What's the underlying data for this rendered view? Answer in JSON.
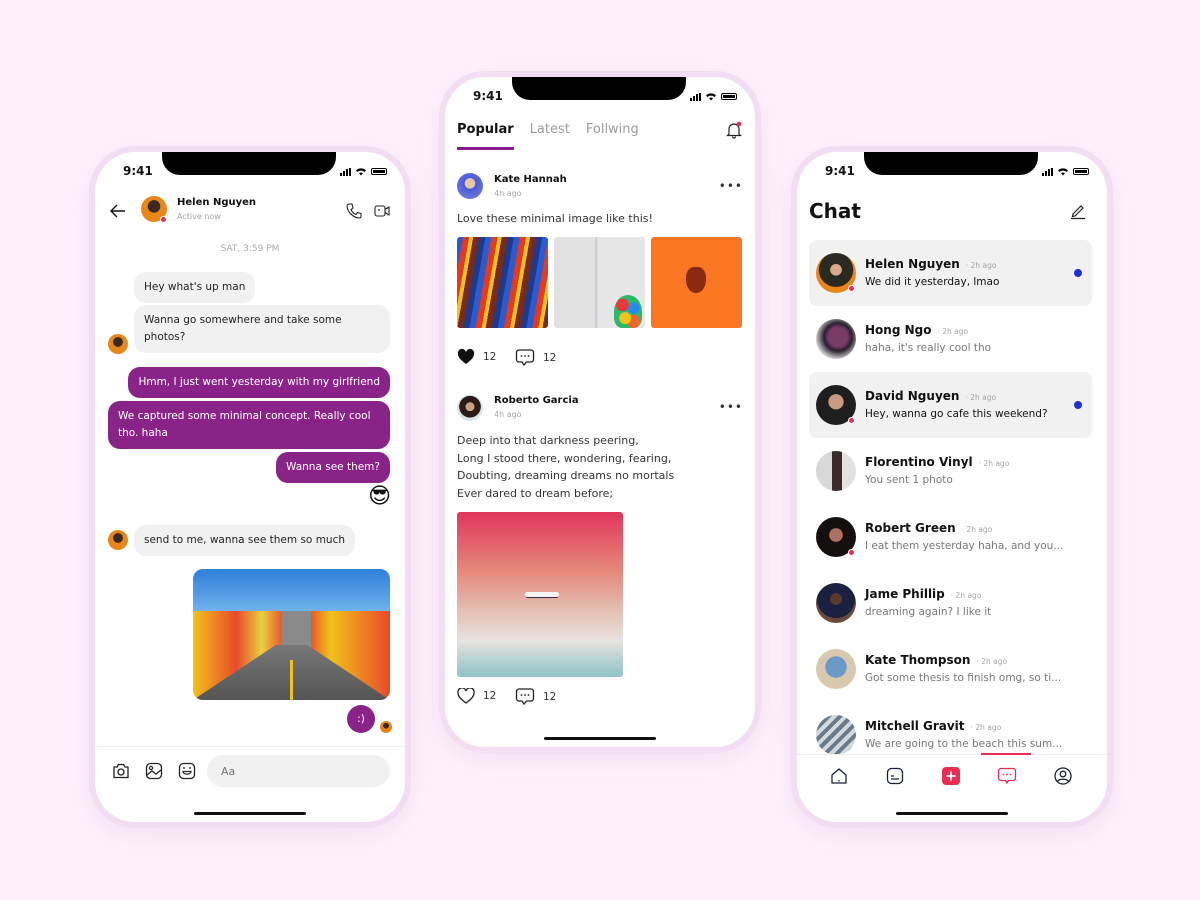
{
  "status": {
    "time": "9:41"
  },
  "conversation": {
    "contact_name": "Helen Nguyen",
    "contact_status": "Active now",
    "date_label": "SAT, 3:59 PM",
    "messages": [
      {
        "from": "them",
        "text": "Hey what's up man"
      },
      {
        "from": "them",
        "text": "Wanna go somewhere and take some photos?"
      },
      {
        "from": "me",
        "text": "Hmm, I just went yesterday with my girlfriend"
      },
      {
        "from": "me",
        "text": "We captured some minimal concept. Really cool tho. haha"
      },
      {
        "from": "me",
        "text": "Wanna see them?"
      },
      {
        "from": "me",
        "emoji": "😎"
      },
      {
        "from": "them",
        "text": "send to me, wanna see them so much"
      },
      {
        "from": "me",
        "image": "colorful-street-photo"
      },
      {
        "from": "me",
        "text": ":)"
      }
    ],
    "composer_placeholder": "Aa",
    "icons": [
      "back-arrow-icon",
      "phone-icon",
      "video-call-icon",
      "camera-icon",
      "gallery-icon",
      "sticker-icon"
    ]
  },
  "feed": {
    "tabs": [
      {
        "label": "Popular",
        "active": true
      },
      {
        "label": "Latest",
        "active": false
      },
      {
        "label": "Follwing",
        "active": false
      }
    ],
    "posts": [
      {
        "author": "Kate Hannah",
        "time": "4h ago",
        "text": "Love these minimal image like this!",
        "images": [
          "colorful-brush-strokes",
          "balloons-white-wall",
          "orange-megaphone"
        ],
        "likes": "12",
        "comments": "12",
        "liked": true
      },
      {
        "author": "Roberto Garcia",
        "time": "4h ago",
        "lines": [
          "Deep into that darkness peering,",
          "Long I stood there, wondering, fearing,",
          "Doubting, dreaming dreams no mortals",
          "Ever dared to dream before;"
        ],
        "images": [
          "airplane-pink-sky"
        ],
        "likes": "12",
        "comments": "12",
        "liked": false
      }
    ]
  },
  "chat_list": {
    "title": "Chat",
    "items": [
      {
        "name": "Helen Nguyen",
        "time": "2h ago",
        "message": "We did it yesterday, lmao",
        "unread": true,
        "online": true
      },
      {
        "name": "Hong Ngo",
        "time": "2h ago",
        "message": "haha, it's really cool tho",
        "unread": false,
        "online": false
      },
      {
        "name": "David Nguyen",
        "time": "2h ago",
        "message": "Hey, wanna go cafe this weekend?",
        "unread": true,
        "online": true
      },
      {
        "name": "Florentino Vinyl",
        "time": "2h ago",
        "message": "You sent 1 photo",
        "unread": false,
        "online": false
      },
      {
        "name": "Robert Green",
        "time": "2h ago",
        "message": "I eat them yesterday haha, and you...",
        "unread": false,
        "online": true
      },
      {
        "name": "Jame Phillip",
        "time": "2h ago",
        "message": "dreaming again? I like it",
        "unread": false,
        "online": false
      },
      {
        "name": "Kate Thompson",
        "time": "2h ago",
        "message": "Got some thesis to finish omg, so ti...",
        "unread": false,
        "online": false
      },
      {
        "name": "Mitchell Gravit",
        "time": "2h ago",
        "message": "We are going to the beach this sum...",
        "unread": false,
        "online": false
      }
    ],
    "nav": [
      "home",
      "feed",
      "create",
      "chat",
      "profile"
    ],
    "active_nav": "chat"
  },
  "colors": {
    "background": "#fdf0fb",
    "accent_purple": "#8a2387",
    "accent_red": "#ec2c52",
    "unread_blue": "#2030d8"
  }
}
